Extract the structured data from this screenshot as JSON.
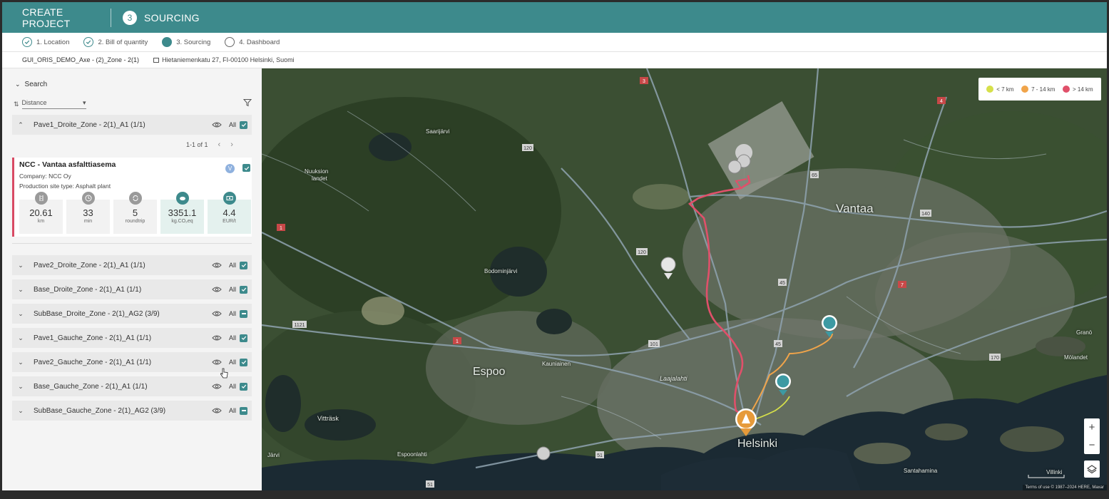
{
  "header": {
    "create_label": "CREATE PROJECT",
    "step_number": "3",
    "step_title": "SOURCING"
  },
  "stepper": {
    "steps": [
      {
        "label": "1. Location",
        "state": "done"
      },
      {
        "label": "2. Bill of quantity",
        "state": "done"
      },
      {
        "label": "3. Sourcing",
        "state": "active"
      },
      {
        "label": "4. Dashboard",
        "state": "todo"
      }
    ]
  },
  "breadcrumb": {
    "project": "GUI_ORIS_DEMO_Axe - (2)_Zone - 2(1)",
    "address": "Hietaniemenkatu 27, FI-00100 Helsinki, Suomi"
  },
  "search": {
    "label": "Search",
    "sort_value": "Distance"
  },
  "groups": [
    {
      "name": "Pave1_Droite_Zone - 2(1)_A1 (1/1)",
      "all": "All",
      "state": "checked",
      "expanded": true
    },
    {
      "name": "Pave2_Droite_Zone - 2(1)_A1 (1/1)",
      "all": "All",
      "state": "checked"
    },
    {
      "name": "Base_Droite_Zone - 2(1)_A1 (1/1)",
      "all": "All",
      "state": "checked"
    },
    {
      "name": "SubBase_Droite_Zone - 2(1)_AG2 (3/9)",
      "all": "All",
      "state": "partial"
    },
    {
      "name": "Pave1_Gauche_Zone - 2(1)_A1 (1/1)",
      "all": "All",
      "state": "checked"
    },
    {
      "name": "Pave2_Gauche_Zone - 2(1)_A1 (1/1)",
      "all": "All",
      "state": "checked"
    },
    {
      "name": "Base_Gauche_Zone - 2(1)_A1 (1/1)",
      "all": "All",
      "state": "checked"
    },
    {
      "name": "SubBase_Gauche_Zone - 2(1)_AG2 (3/9)",
      "all": "All",
      "state": "partial"
    }
  ],
  "pager": {
    "text": "1-1 of 1"
  },
  "supplier": {
    "title": "NCC - Vantaa asfalttiasema",
    "company": "Company: NCC Oy",
    "site_type": "Production site type: Asphalt plant",
    "badge": "V",
    "metrics": [
      {
        "icon": "distance-icon",
        "value": "20.61",
        "unit": "km"
      },
      {
        "icon": "clock-icon",
        "value": "33",
        "unit": "min"
      },
      {
        "icon": "roundtrip-icon",
        "value": "5",
        "unit": "roundtrip"
      },
      {
        "icon": "co2-icon",
        "value": "3351.1",
        "unit": "kg.CO₂eq"
      },
      {
        "icon": "money-icon",
        "value": "4.4",
        "unit": "EUR/t"
      }
    ]
  },
  "map": {
    "legend": [
      {
        "label": "< 7 km",
        "color": "#d6e04a"
      },
      {
        "label": "7 - 14 km",
        "color": "#f0a44a"
      },
      {
        "label": "> 14 km",
        "color": "#e0506a"
      }
    ],
    "labels": {
      "vantaa": "Vantaa",
      "espoo": "Espoo",
      "helsinki": "Helsinki",
      "saarijarvi": "Saarijärvi",
      "kauniainen": "Kauniainen",
      "laajalahti": "Laajalahti",
      "vittrask": "Vitträsk",
      "espoonlahti": "Espoonlahti",
      "bodom": "Bodominjärvi",
      "jarvi": "Järvi",
      "grano": "Granö",
      "molandet": "Mölandet",
      "villinki": "Villinki",
      "santahamina": "Santahamina",
      "nuuksion": "Nuuksion",
      "landet": "landet"
    },
    "road_shields": [
      "3",
      "4",
      "120",
      "65",
      "1",
      "140",
      "120",
      "45",
      "7",
      "1121",
      "1",
      "101",
      "45",
      "170",
      "51",
      "51"
    ],
    "zoom_in": "+",
    "zoom_out": "−",
    "attribution": "Terms of use   © 1987–2024 HERE, Maxar"
  }
}
